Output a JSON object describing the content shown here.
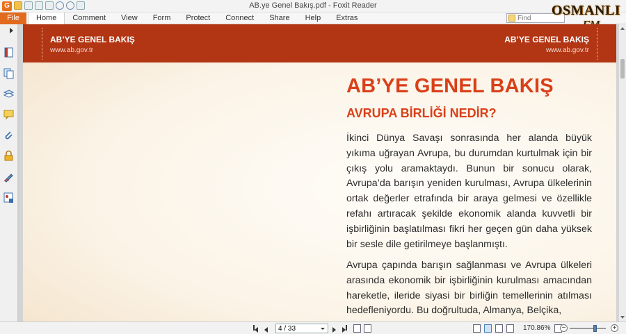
{
  "window": {
    "title": "AB.ye Genel Bakış.pdf - Foxit Reader",
    "app_logo": "G"
  },
  "quick_access": {
    "icons": [
      "open-folder-icon",
      "save-icon",
      "print-icon",
      "email-icon",
      "undo-icon",
      "redo-icon",
      "hand-tool-icon"
    ]
  },
  "ribbon": {
    "file_label": "File",
    "tabs": [
      {
        "label": "Home",
        "active": true
      },
      {
        "label": "Comment"
      },
      {
        "label": "View"
      },
      {
        "label": "Form"
      },
      {
        "label": "Protect"
      },
      {
        "label": "Connect"
      },
      {
        "label": "Share"
      },
      {
        "label": "Help"
      },
      {
        "label": "Extras"
      }
    ],
    "find_placeholder": "Find"
  },
  "watermark": {
    "line1": "OSMANLI",
    "line2": "FM"
  },
  "sidebar": {
    "icons": [
      "bookmark-icon",
      "pages-icon",
      "layers-icon",
      "comments-icon",
      "attachment-icon",
      "security-lock-icon",
      "signature-icon",
      "form-fields-icon"
    ]
  },
  "page_header": {
    "left_title": "AB’YE GENEL BAKIŞ",
    "left_url": "www.ab.gov.tr",
    "right_title": "AB’YE GENEL BAKIŞ",
    "right_url": "www.ab.gov.tr",
    "color": "#b23514"
  },
  "document": {
    "title": "AB’YE GENEL BAKIŞ",
    "subtitle": "AVRUPA BİRLİĞİ NEDİR?",
    "paragraph1": "İkinci Dünya Savaşı sonrasında her alanda büyük yıkıma uğrayan Avrupa, bu durumdan kurtulmak için bir çıkış yolu aramaktaydı. Bunun bir sonucu olarak, Avrupa’da barışın yeniden kurulması, Avrupa ülkelerinin ortak değerler etrafında bir araya gelmesi ve özellikle refahı artıracak şekilde ekonomik alanda kuvvetli bir işbirliğinin başlatılması fikri her geçen gün daha yüksek bir sesle dile getirilmeye başlanmıştı.",
    "paragraph2": "Avrupa çapında barışın sağlanması ve Avrupa ülkeleri arasında ekonomik bir işbirliğinin kurulması amacından hareketle, ileride siyasi bir birliğin temellerinin atılması hedefleniyordu. Bu doğrultuda, Almanya, Belçika,",
    "accent_color": "#d94019"
  },
  "statusbar": {
    "page_value": "4 / 33",
    "zoom": "170.86%",
    "zoom_level_fraction": 0.65
  }
}
